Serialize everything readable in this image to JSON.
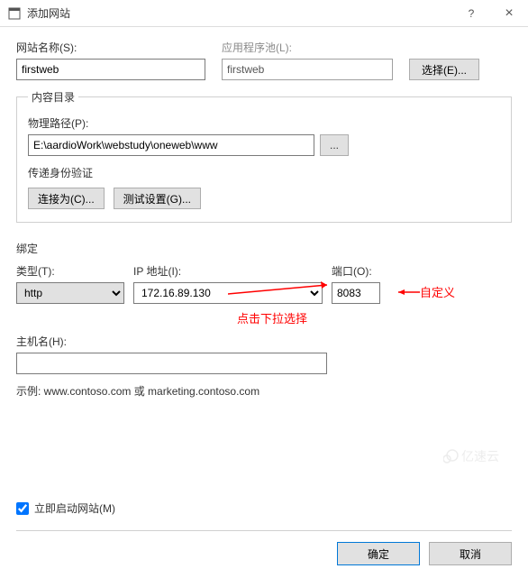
{
  "window": {
    "title": "添加网站",
    "help_icon": "?",
    "close_icon": "×"
  },
  "site": {
    "name_label": "网站名称(S):",
    "name_value": "firstweb",
    "pool_label": "应用程序池(L):",
    "pool_value": "firstweb",
    "select_button": "选择(E)..."
  },
  "content_dir": {
    "legend": "内容目录",
    "path_label": "物理路径(P):",
    "path_value": "E:\\aardioWork\\webstudy\\oneweb\\www",
    "browse": "...",
    "auth_label": "传递身份验证",
    "connect_as": "连接为(C)...",
    "test_settings": "测试设置(G)..."
  },
  "binding": {
    "section_label": "绑定",
    "type_label": "类型(T):",
    "type_value": "http",
    "ip_label": "IP 地址(I):",
    "ip_value": "172.16.89.130",
    "port_label": "端口(O):",
    "port_value": "8083",
    "hostname_label": "主机名(H):",
    "hostname_value": "",
    "example": "示例: www.contoso.com 或 marketing.contoso.com"
  },
  "annotations": {
    "custom": "自定义",
    "dropdown_hint": "点击下拉选择"
  },
  "footer": {
    "start_site": "立即启动网站(M)",
    "start_checked": true,
    "ok": "确定",
    "cancel": "取消"
  },
  "watermark": "亿速云"
}
